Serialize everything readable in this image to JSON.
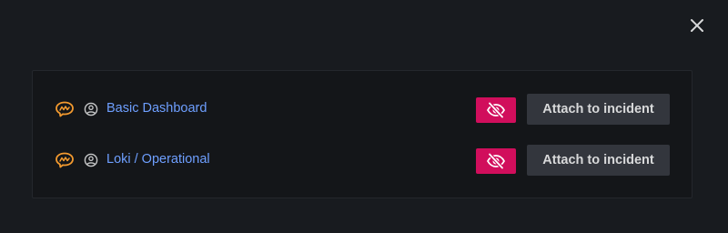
{
  "modal": {
    "close_icon": "close-icon"
  },
  "dashboards": [
    {
      "name": "Basic Dashboard",
      "app_icon": "grafana-brain-icon",
      "user_icon": "user-circle-icon",
      "hide_icon": "eye-slash-icon",
      "attach_label": "Attach to incident"
    },
    {
      "name": "Loki / Operational",
      "app_icon": "grafana-brain-icon",
      "user_icon": "user-circle-icon",
      "hide_icon": "eye-slash-icon",
      "attach_label": "Attach to incident"
    }
  ],
  "colors": {
    "background": "#181b1f",
    "panel": "#141619",
    "link": "#6e9fff",
    "hide_button": "#d10e5c",
    "secondary_button": "#33363d",
    "brand_orange": "#f59b2f"
  }
}
